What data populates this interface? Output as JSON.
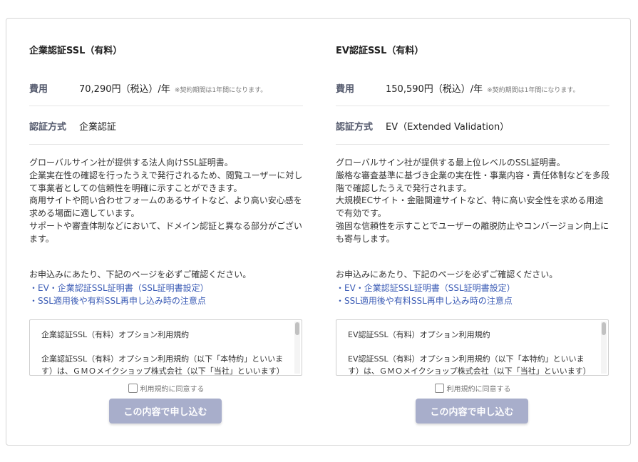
{
  "plans": [
    {
      "title": "企業認証SSL（有料）",
      "price_label": "費用",
      "price_value": "70,290円（税込）/年",
      "price_note": "※契約期間は1年間になります。",
      "method_label": "認証方式",
      "method_value": "企業認証",
      "description": [
        "グローバルサイン社が提供する法人向けSSL証明書。",
        "企業実在性の確認を行ったうえで発行されるため、閲覧ユーザーに対して事業者としての信頼性を明確に示すことができます。",
        "商用サイトや問い合わせフォームのあるサイトなど、より高い安心感を求める場面に適しています。",
        "サポートや審査体制などにおいて、ドメイン認証と異なる部分がございます。"
      ],
      "confirm_text": "お申込みにあたり、下記のページを必ずご確認ください。",
      "links": [
        "・EV・企業認証SSL証明書（SSL証明書設定）",
        "・SSL適用後や有料SSL再申し込み時の注意点"
      ],
      "terms_title": "企業認証SSL（有料）オプション利用規約",
      "terms_body": "企業認証SSL（有料）オプション利用規約（以下「本特約」といいます）は、ＧＭＯメイクショップ株式会社（以下「当社」といいます）",
      "agree_label": "利用規約に同意する",
      "submit_label": "この内容で申し込む"
    },
    {
      "title": "EV認証SSL（有料）",
      "price_label": "費用",
      "price_value": "150,590円（税込）/年",
      "price_note": "※契約期間は1年間になります。",
      "method_label": "認証方式",
      "method_value": "EV（Extended Validation）",
      "description": [
        "グローバルサイン社が提供する最上位レベルのSSL証明書。",
        "厳格な審査基準に基づき企業の実在性・事業内容・責任体制などを多段階で確認したうえで発行されます。",
        "大規模ECサイト・金融関連サイトなど、特に高い安全性を求める用途で有効です。",
        "強固な信頼性を示すことでユーザーの離脱防止やコンバージョン向上にも寄与します。"
      ],
      "confirm_text": "お申込みにあたり、下記のページを必ずご確認ください。",
      "links": [
        "・EV・企業認証SSL証明書（SSL証明書設定）",
        "・SSL適用後や有料SSL再申し込み時の注意点"
      ],
      "terms_title": "EV認証SSL（有料）オプション利用規約",
      "terms_body": "EV認証SSL（有料）オプション利用規約（以下「本特約」といいます）は、ＧＭＯメイクショップ株式会社（以下「当社」といいます）",
      "agree_label": "利用規約に同意する",
      "submit_label": "この内容で申し込む"
    }
  ],
  "colors": {
    "link": "#3a5bb5",
    "button_disabled": "#a8aecb",
    "label": "#555b6e"
  }
}
